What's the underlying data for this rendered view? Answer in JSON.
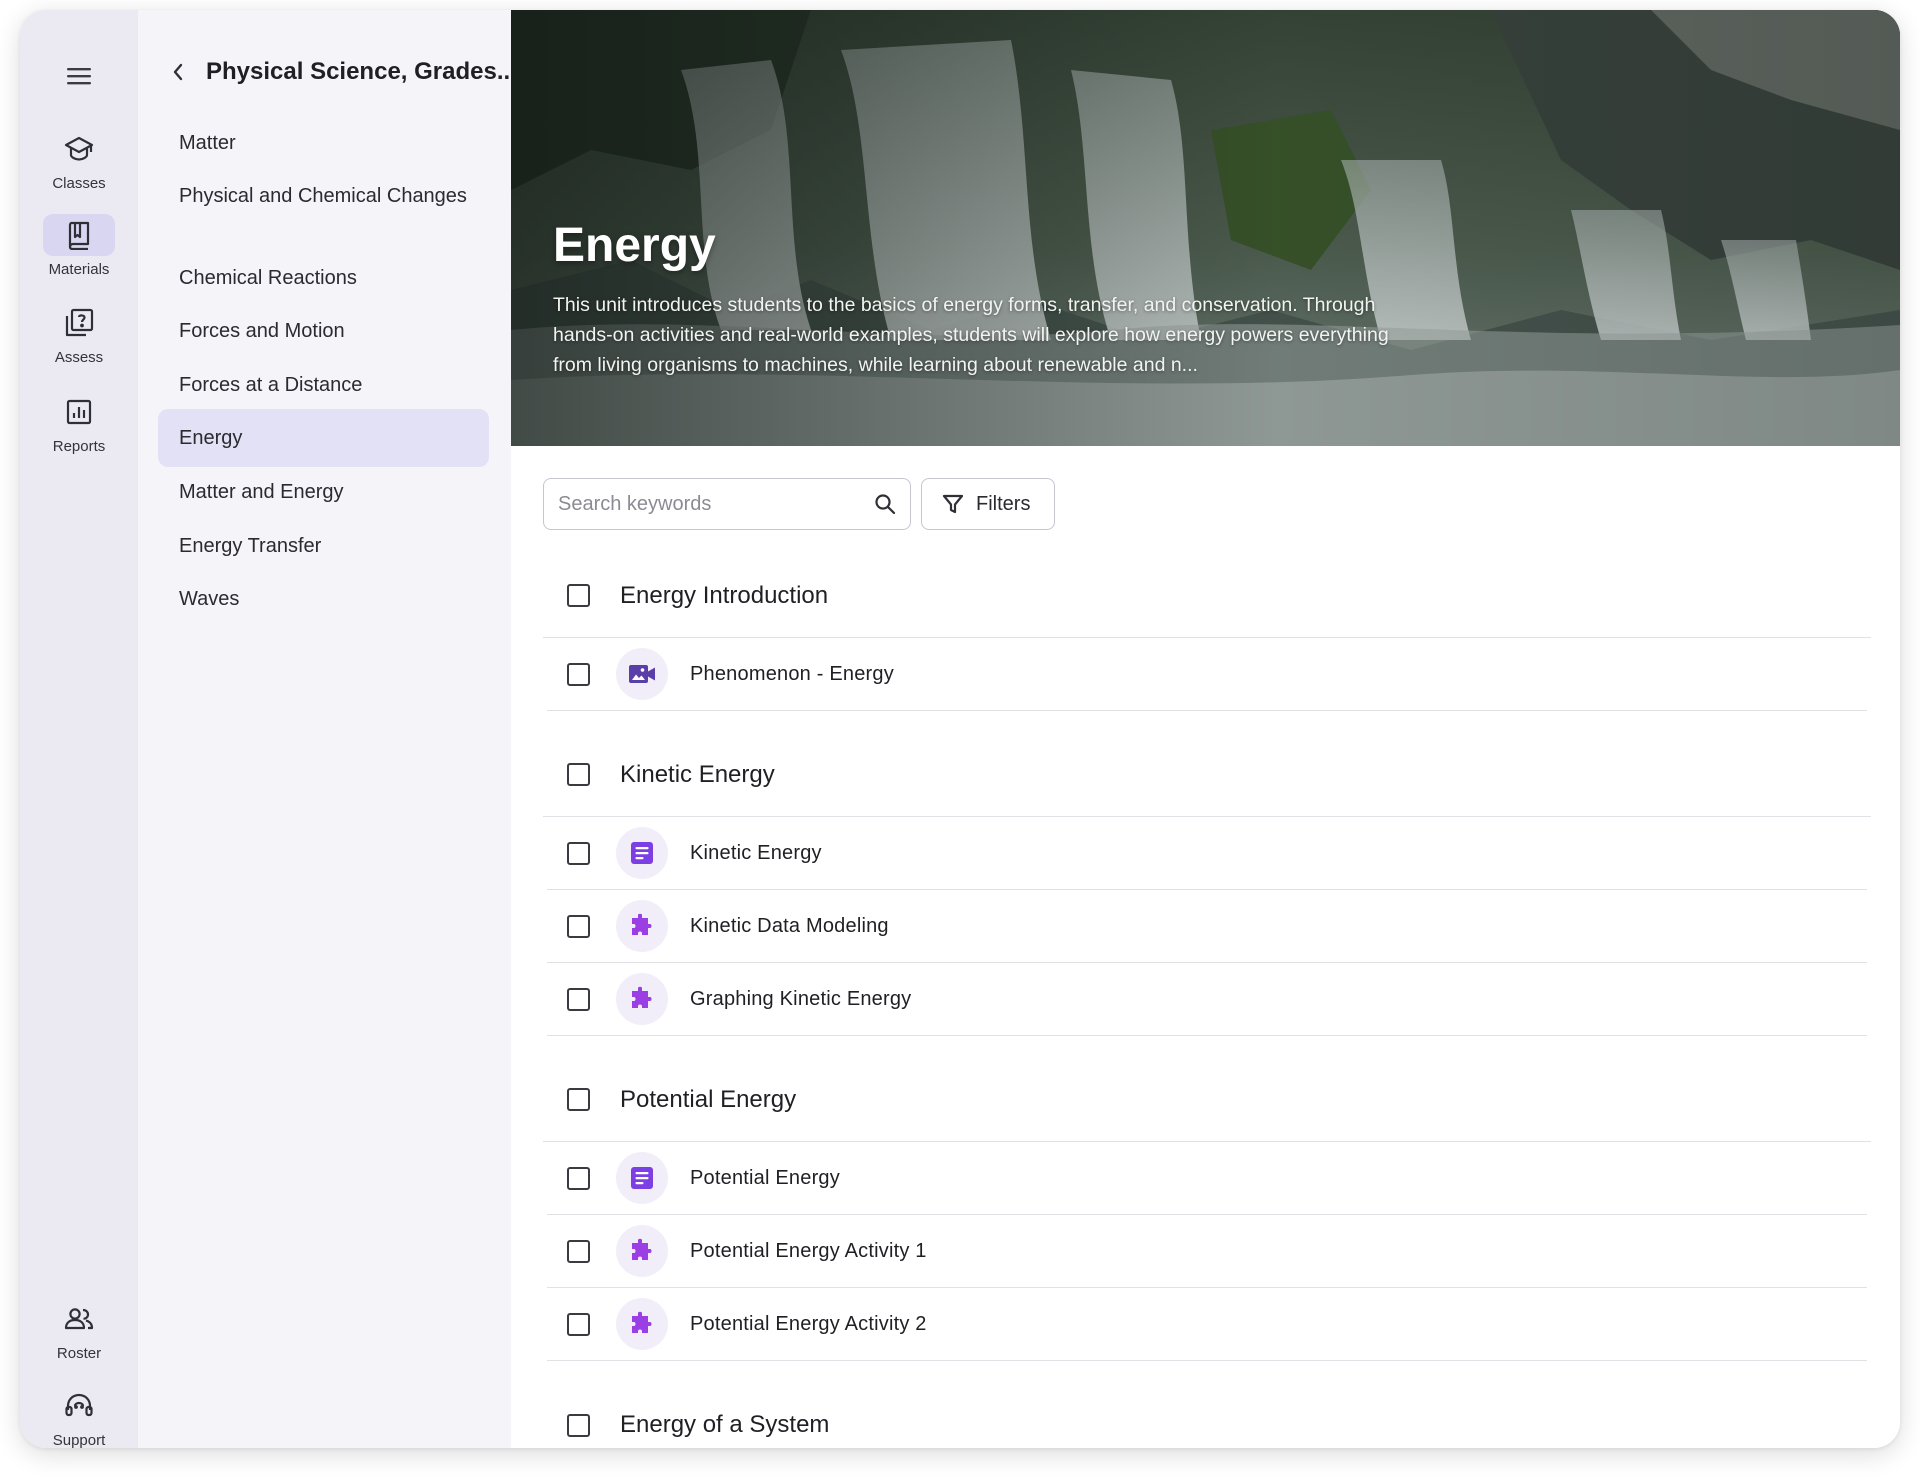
{
  "rail": {
    "items": [
      {
        "label": "Classes",
        "icon": "graduation-cap-icon",
        "active": false
      },
      {
        "label": "Materials",
        "icon": "book-icon",
        "active": true
      },
      {
        "label": "Assess",
        "icon": "question-box-icon",
        "active": false
      },
      {
        "label": "Reports",
        "icon": "bar-chart-icon",
        "active": false
      }
    ],
    "bottom_items": [
      {
        "label": "Roster",
        "icon": "people-icon"
      },
      {
        "label": "Support",
        "icon": "headset-icon"
      }
    ]
  },
  "subnav": {
    "title": "Physical Science, Grades...",
    "items": [
      {
        "label": "Matter"
      },
      {
        "label": "Physical and Chemical Changes"
      },
      {
        "label": "Chemical Reactions"
      },
      {
        "label": "Forces and Motion"
      },
      {
        "label": "Forces at a Distance"
      },
      {
        "label": "Energy",
        "active": true
      },
      {
        "label": "Matter and Energy"
      },
      {
        "label": "Energy Transfer"
      },
      {
        "label": "Waves"
      }
    ]
  },
  "hero": {
    "title": "Energy",
    "description": "This unit introduces students to the basics of energy forms, transfer, and conservation. Through hands-on activities and real-world examples, students will explore how energy powers everything from living organisms to machines, while learning about renewable and n..."
  },
  "toolbar": {
    "search_placeholder": "Search keywords",
    "filters_label": "Filters"
  },
  "sections": [
    {
      "title": "Energy Introduction",
      "items": [
        {
          "label": "Phenomenon - Energy",
          "icon": "video-icon"
        }
      ]
    },
    {
      "title": "Kinetic Energy",
      "items": [
        {
          "label": "Kinetic Energy",
          "icon": "document-icon"
        },
        {
          "label": "Kinetic Data Modeling",
          "icon": "puzzle-icon"
        },
        {
          "label": "Graphing Kinetic Energy",
          "icon": "puzzle-icon"
        }
      ]
    },
    {
      "title": "Potential Energy",
      "items": [
        {
          "label": "Potential Energy",
          "icon": "document-icon"
        },
        {
          "label": "Potential Energy Activity 1",
          "icon": "puzzle-icon"
        },
        {
          "label": "Potential Energy Activity 2",
          "icon": "puzzle-icon"
        }
      ]
    },
    {
      "title": "Energy of a System",
      "items": []
    }
  ],
  "colors": {
    "accent": "#7b3fe4",
    "video_icon": "#5b3fa8",
    "rail_bg": "#ebeaf2",
    "rail_active": "#d9d6f2",
    "subnav_bg": "#f5f4f9",
    "subnav_active": "#e3e1f5"
  }
}
